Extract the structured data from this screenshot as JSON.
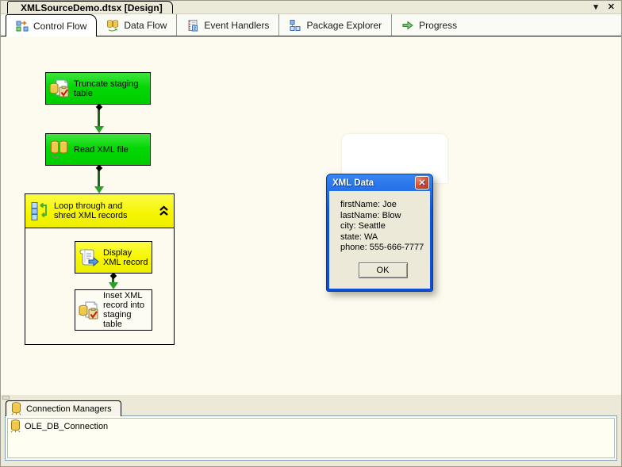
{
  "window": {
    "doc_tab": "XMLSourceDemo.dtsx [Design]",
    "controls": {
      "dropdown": "▾",
      "close": "✕"
    }
  },
  "tabs": [
    {
      "label": "Control Flow",
      "icon": "control-flow-icon",
      "active": true
    },
    {
      "label": "Data Flow",
      "icon": "data-flow-icon",
      "active": false
    },
    {
      "label": "Event Handlers",
      "icon": "event-handlers-icon",
      "active": false
    },
    {
      "label": "Package Explorer",
      "icon": "package-explorer-icon",
      "active": false
    },
    {
      "label": "Progress",
      "icon": "progress-icon",
      "active": false
    }
  ],
  "canvas": {
    "tasks": {
      "truncate": {
        "label": "Truncate staging table",
        "color": "#04D804",
        "icon": "execute-sql-icon"
      },
      "read_xml": {
        "label": "Read XML file",
        "color": "#04D804",
        "icon": "data-flow-task-icon"
      },
      "loop": {
        "label": "Loop through and shred XML records",
        "color": "#F5F500",
        "icon": "foreach-loop-icon"
      },
      "display": {
        "label": "Display XML record",
        "color": "#F5F500",
        "icon": "script-task-icon"
      },
      "insert": {
        "label": "Inset XML record into staging table",
        "color": "#FDFCF3",
        "icon": "execute-sql-icon"
      }
    },
    "arrow_color": "#156B15"
  },
  "dialog": {
    "title": "XML Data",
    "close_glyph": "✕",
    "lines": [
      "firstName: Joe",
      "lastName: Blow",
      "city: Seattle",
      "state: WA",
      "phone: 555-666-7777"
    ],
    "ok_label": "OK",
    "title_color": "#1156D8"
  },
  "connection_managers": {
    "tab_label": "Connection Managers",
    "items": [
      {
        "name": "OLE_DB_Connection",
        "icon": "connection-cylinder-icon"
      }
    ]
  },
  "colors": {
    "chrome_tan": "#ECE9D8",
    "canvas_cream": "#FDFBF0",
    "task_green": "#04D804",
    "task_yellow": "#F5F500",
    "list_bg": "#FFFEF2"
  }
}
